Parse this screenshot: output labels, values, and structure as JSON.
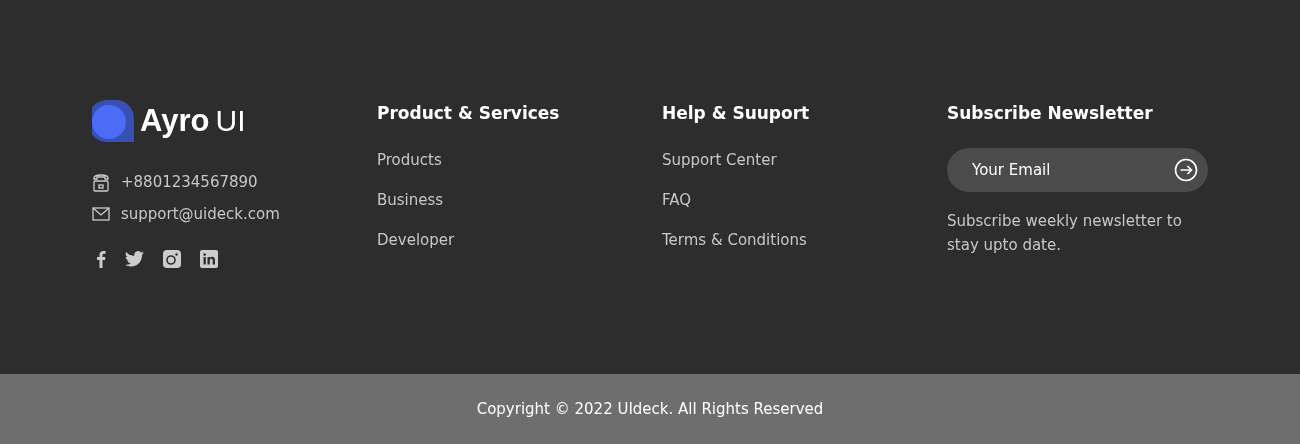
{
  "brand": {
    "name": "Ayro",
    "suffix": "UI"
  },
  "contacts": [
    {
      "kind": "phone",
      "text": "+8801234567890"
    },
    {
      "kind": "email",
      "text": "support@uideck.com"
    }
  ],
  "socials": [
    {
      "kind": "facebook"
    },
    {
      "kind": "twitter"
    },
    {
      "kind": "instagram"
    },
    {
      "kind": "linkedin"
    }
  ],
  "columns": [
    {
      "title": "Product & Services",
      "links": [
        "Products",
        "Business",
        "Developer"
      ]
    },
    {
      "title": "Help & Suuport",
      "links": [
        "Support Center",
        "FAQ",
        "Terms & Conditions"
      ]
    }
  ],
  "newsletter": {
    "title": "Subscribe Newsletter",
    "placeholder": "Your Email",
    "note": "Subscribe weekly newsletter to stay upto date."
  },
  "copyright": "Copyright © 2022 UIdeck. All Rights Reserved"
}
